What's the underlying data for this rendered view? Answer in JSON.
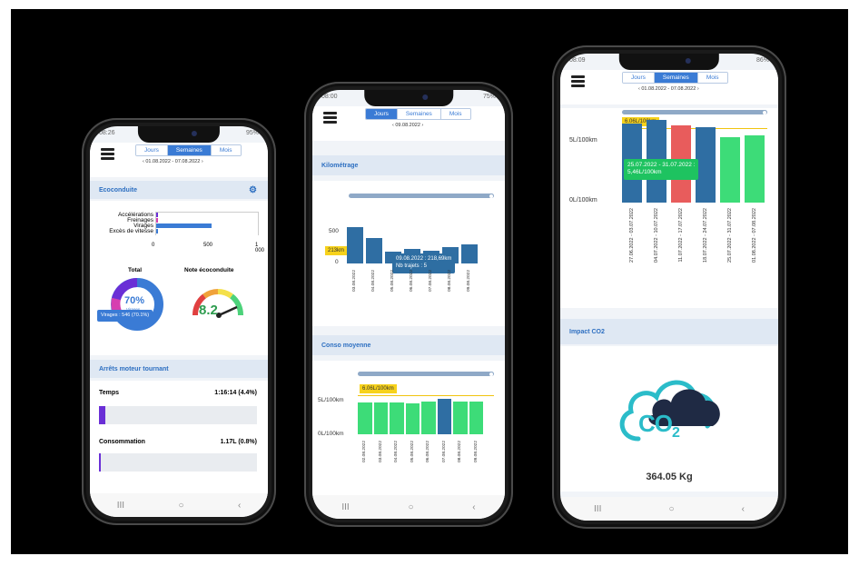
{
  "phone1": {
    "status_time": "08:26",
    "status_battery": "95%",
    "tabs": [
      "Jours",
      "Semaines",
      "Mois"
    ],
    "active_tab": 1,
    "date_range": "‹  01.08.2022 - 07.08.2022  ›",
    "eco": {
      "title": "Ecoconduite",
      "labels": [
        "Accélérations",
        "Freinages",
        "Virages",
        "Excès de vitesse"
      ],
      "values": [
        "8",
        "",
        "546",
        "4"
      ],
      "axis": [
        "0",
        "500",
        "1 000"
      ],
      "total_title": "Total",
      "total_value": "70%",
      "total_sub": "Virages",
      "total_tooltip": "Virages : 546 (70.1%)",
      "note_title": "Note écoconduite",
      "note_value": "8.2",
      "gauge_ticks": [
        "0",
        "2",
        "4",
        "6",
        "8",
        "10"
      ]
    },
    "arrets": {
      "title": "Arrêts moteur tournant",
      "temps_label": "Temps",
      "temps_value": "1:16:14 (4.4%)",
      "conso_label": "Consommation",
      "conso_value": "1.17L (0.8%)"
    }
  },
  "phone2": {
    "status_time": "08:00",
    "status_battery": "75%",
    "tabs": [
      "Jours",
      "Semaines",
      "Mois"
    ],
    "active_tab": 0,
    "date": "‹  09.08.2022  ›",
    "km": {
      "title": "Kilométrage",
      "y_ticks": [
        "500",
        "0"
      ],
      "highlight": "213km",
      "tooltip_line1": "09.08.2022 : 218,69km",
      "tooltip_line2": "Nb trajets : 5",
      "dates": [
        "03.08.2022",
        "04.08.2022",
        "05.08.2022",
        "06.08.2022",
        "07.08.2022",
        "08.08.2022",
        "09.08.2022"
      ]
    },
    "conso": {
      "title": "Conso moyenne",
      "y_ticks": [
        "5L/100km",
        "0L/100km"
      ],
      "highlight": "6.06L/100km",
      "dates": [
        "02.08.2022",
        "03.08.2022",
        "04.08.2022",
        "05.08.2022",
        "06.08.2022",
        "07.08.2022",
        "08.08.2022",
        "09.08.2022"
      ]
    }
  },
  "phone3": {
    "status_time": "08:09",
    "status_battery": "86%",
    "tabs": [
      "Jours",
      "Semaines",
      "Mois"
    ],
    "active_tab": 1,
    "date_range": "‹  01.08.2022 - 07.08.2022  ›",
    "weekly": {
      "y_ticks": [
        "5L/100km",
        "0L/100km"
      ],
      "highlight": "6.06L/100km",
      "tooltip_line1": "25.07.2022 - 31.07.2022 :",
      "tooltip_line2": "5,46L/100km",
      "dates": [
        "27.06.2022 - 03.07.2022",
        "04.07.2022 - 10.07.2022",
        "11.07.2022 - 17.07.2022",
        "18.07.2022 - 24.07.2022",
        "25.07.2022 - 31.07.2022",
        "01.08.2022 - 07.08.2022"
      ]
    },
    "co2": {
      "title": "Impact CO2",
      "label": "CO",
      "subscript": "2",
      "value": "364.05 Kg"
    }
  },
  "nav_icons": [
    "recent-apps-icon",
    "home-icon",
    "back-icon"
  ],
  "nav_glyphs": [
    "III",
    "○",
    "‹"
  ],
  "colors": {
    "accent_blue": "#3a7bd5",
    "section_bg": "#dfe8f3",
    "bar_blue": "#2f6ea3",
    "bar_green": "#3ddc78",
    "bar_red": "#e85c5c",
    "highlight_yellow": "#f7d21b",
    "purple": "#6a2fd6"
  },
  "chart_data": [
    {
      "type": "bar",
      "title": "Ecoconduite",
      "categories": [
        "Accélérations",
        "Freinages",
        "Virages",
        "Excès de vitesse"
      ],
      "values": [
        8,
        30,
        546,
        4
      ],
      "xlim": [
        0,
        1000
      ]
    },
    {
      "type": "bar",
      "title": "Kilométrage",
      "categories": [
        "03.08.2022",
        "04.08.2022",
        "05.08.2022",
        "06.08.2022",
        "07.08.2022",
        "08.08.2022",
        "09.08.2022"
      ],
      "values": [
        420,
        290,
        130,
        170,
        150,
        190,
        219
      ],
      "ylim": [
        0,
        550
      ]
    },
    {
      "type": "bar",
      "title": "Conso moyenne",
      "categories": [
        "02.08.2022",
        "03.08.2022",
        "04.08.2022",
        "05.08.2022",
        "06.08.2022",
        "07.08.2022",
        "08.08.2022",
        "09.08.2022"
      ],
      "values": [
        6.0,
        6.0,
        5.9,
        5.8,
        6.1,
        6.6,
        6.1,
        6.1
      ],
      "ylim": [
        0,
        8
      ]
    },
    {
      "type": "bar",
      "title": "",
      "categories": [
        "27.06.2022 - 03.07.2022",
        "04.07.2022 - 10.07.2022",
        "11.07.2022 - 17.07.2022",
        "18.07.2022 - 24.07.2022",
        "25.07.2022 - 31.07.2022",
        "01.08.2022 - 07.08.2022"
      ],
      "values": [
        6.6,
        6.9,
        6.5,
        6.3,
        5.46,
        5.6
      ],
      "ylim": [
        0,
        7
      ]
    }
  ]
}
